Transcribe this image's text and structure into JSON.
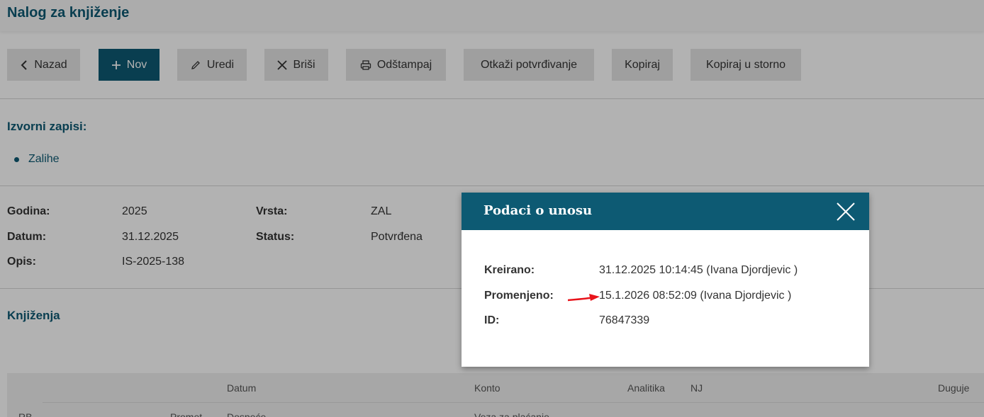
{
  "header": {
    "title": "Nalog za knjiženje"
  },
  "toolbar": {
    "back_label": "Nazad",
    "new_label": "Nov",
    "edit_label": "Uredi",
    "delete_label": "Briši",
    "print_label": "Odštampaj",
    "cancel_confirm_label": "Otkaži potvrđivanje",
    "copy_label": "Kopiraj",
    "copy_storno_label": "Kopiraj u storno"
  },
  "sources": {
    "title": "Izvorni zapisi:",
    "items": [
      {
        "label": "Zalihe"
      }
    ]
  },
  "details": {
    "year_label": "Godina:",
    "year_value": "2025",
    "date_label": "Datum:",
    "date_value": "31.12.2025",
    "desc_label": "Opis:",
    "desc_value": "IS-2025-138",
    "type_label": "Vrsta:",
    "type_value": "ZAL",
    "status_label": "Status:",
    "status_value": "Potvrđena"
  },
  "postings": {
    "title": "Knjiženja",
    "columns_row1": {
      "datum": "Datum",
      "konto": "Konto",
      "analitika": "Analitika",
      "nj": "NJ",
      "duguje": "Duguje"
    },
    "columns_row2": {
      "rb": "RB",
      "promet": "Promet",
      "dospece": "Dospeće",
      "veza": "Veza za plaćanje"
    }
  },
  "modal": {
    "title": "Podaci o unosu",
    "created_label": "Kreirano:",
    "created_value": "31.12.2025 10:14:45 (Ivana Djordjevic )",
    "changed_label": "Promenjeno:",
    "changed_value": "15.1.2026 08:52:09 (Ivana Djordjevic )",
    "id_label": "ID:",
    "id_value": "76847339"
  },
  "colors": {
    "accent": "#0d5a73",
    "button_bg": "#e4e4e4",
    "annotation_arrow": "#e8141b"
  },
  "icons": {
    "back": "chevron-left-icon",
    "new": "plus-icon",
    "edit": "pencil-icon",
    "delete": "x-icon",
    "print": "printer-icon",
    "close": "close-icon",
    "annotation": "red-arrow-icon"
  }
}
